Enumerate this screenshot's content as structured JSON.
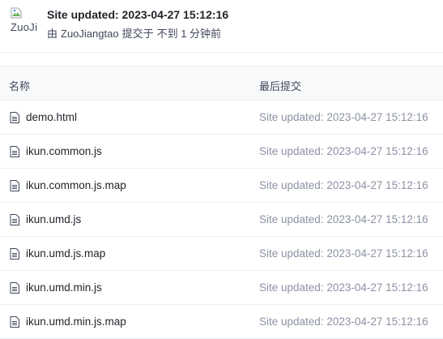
{
  "commit": {
    "avatar_alt": "ZuoJi",
    "title": "Site updated: 2023-04-27 15:12:16",
    "by": "由",
    "author": "ZuoJiangtao",
    "action": "提交于",
    "time": "不到 1 分钟前"
  },
  "table": {
    "headers": {
      "name": "名称",
      "last_commit": "最后提交"
    },
    "rows": [
      {
        "name": "demo.html",
        "commit": "Site updated: 2023-04-27 15:12:16",
        "icon": "file-icon"
      },
      {
        "name": "ikun.common.js",
        "commit": "Site updated: 2023-04-27 15:12:16",
        "icon": "file-icon"
      },
      {
        "name": "ikun.common.js.map",
        "commit": "Site updated: 2023-04-27 15:12:16",
        "icon": "file-icon"
      },
      {
        "name": "ikun.umd.js",
        "commit": "Site updated: 2023-04-27 15:12:16",
        "icon": "file-icon"
      },
      {
        "name": "ikun.umd.js.map",
        "commit": "Site updated: 2023-04-27 15:12:16",
        "icon": "file-icon"
      },
      {
        "name": "ikun.umd.min.js",
        "commit": "Site updated: 2023-04-27 15:12:16",
        "icon": "file-icon"
      },
      {
        "name": "ikun.umd.min.js.map",
        "commit": "Site updated: 2023-04-27 15:12:16",
        "icon": "file-icon"
      }
    ]
  },
  "colors": {
    "text_primary": "#1f2329",
    "text_secondary": "#8c92a4",
    "header_bg": "#f8f9fb",
    "border": "#eceff3"
  }
}
